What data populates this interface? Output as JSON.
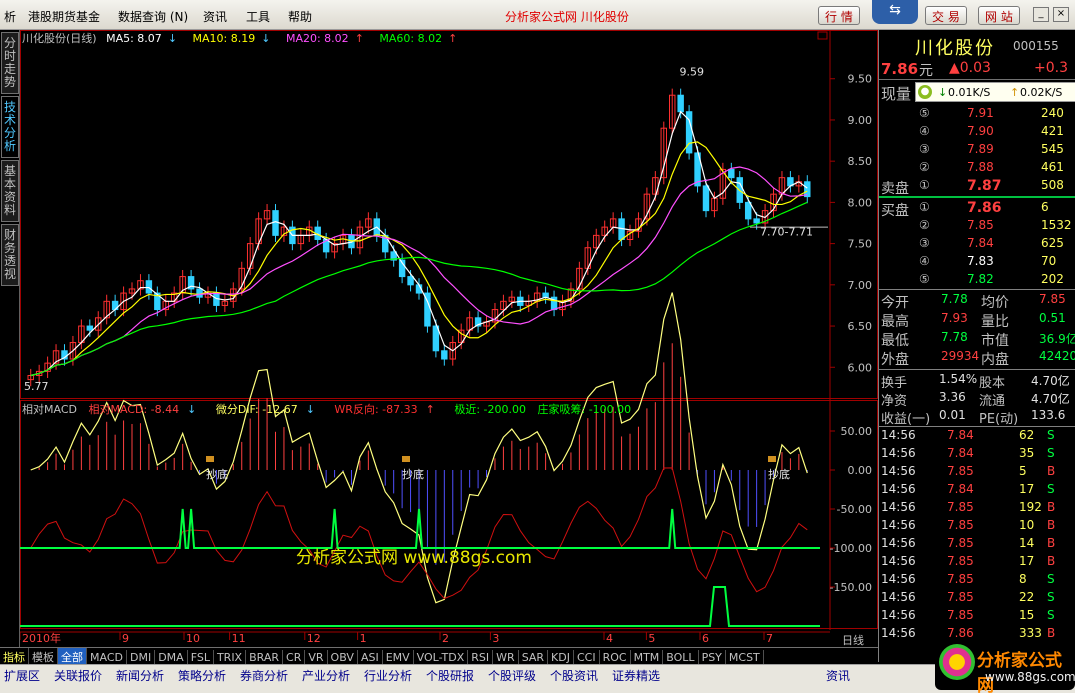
{
  "menu": {
    "items": [
      "析",
      "港股期货基金",
      "数据查询 (N)",
      "资讯",
      "工具",
      "帮助"
    ],
    "title": "分析家公式网  川化股份",
    "btn_hq": "行 情",
    "btn_jy": "交 易",
    "btn_wz": "网 站",
    "btn_zx": "资讯"
  },
  "side_tabs": [
    "分时走势",
    "技术分析",
    "基本资料",
    "财务透视"
  ],
  "main_header": {
    "stock": "川化股份(日线)",
    "ma5": "MA5: 8.07",
    "ma10": "MA10: 8.19",
    "ma20": "MA20: 8.02",
    "ma60": "MA60: 8.02",
    "arrows": [
      "↓",
      "↓",
      "↑",
      "↑"
    ],
    "colors": {
      "ma5": "#ffffff",
      "ma10": "#ffff00",
      "ma20": "#ff50ff",
      "ma60": "#00ff00"
    }
  },
  "indicator_header": {
    "name": "相对MACD",
    "macd": "相对MACD: -8.44",
    "dif": "微分DIF: -12.67",
    "wr": "WR反向: -87.33",
    "ext": "极近: -200.00",
    "zj": "庄家吸筹: -100.00"
  },
  "chart_data": {
    "type": "candlestick",
    "price_axis": {
      "ticks": [
        "9.50",
        "9.00",
        "8.50",
        "8.00",
        "7.50",
        "7.00",
        "6.50",
        "6.00"
      ],
      "values": [
        9.5,
        9.0,
        8.5,
        8.0,
        7.5,
        7.0,
        6.5,
        6.0
      ],
      "ylim": [
        5.7,
        9.8
      ]
    },
    "indicator_axis": {
      "ticks": [
        "50.00",
        "0.00",
        "-50.00",
        "-100.00",
        "-150.00"
      ],
      "values": [
        50,
        0,
        -50,
        -100,
        -150
      ]
    },
    "x_labels": [
      "2010年",
      "9",
      "10",
      "11",
      "12",
      "1",
      "2",
      "3",
      "4",
      "5",
      "6",
      "7"
    ],
    "x_positions": [
      0,
      0.125,
      0.205,
      0.262,
      0.356,
      0.422,
      0.525,
      0.588,
      0.73,
      0.783,
      0.85,
      0.93
    ],
    "annotations": {
      "high": "9.59",
      "low": "5.77",
      "range": "7.70-7.71",
      "bottom_labels": [
        "抄底",
        "抄底",
        "抄底"
      ]
    },
    "closes": [
      5.9,
      5.95,
      6.05,
      6.2,
      6.1,
      6.3,
      6.5,
      6.45,
      6.6,
      6.8,
      6.7,
      6.9,
      6.95,
      7.05,
      6.9,
      6.7,
      6.8,
      6.9,
      7.1,
      6.95,
      6.85,
      6.9,
      6.75,
      6.8,
      6.95,
      7.2,
      7.5,
      7.8,
      7.9,
      7.6,
      7.7,
      7.5,
      7.6,
      7.7,
      7.55,
      7.4,
      7.5,
      7.6,
      7.45,
      7.7,
      7.8,
      7.6,
      7.4,
      7.3,
      7.1,
      7.0,
      6.9,
      6.5,
      6.2,
      6.1,
      6.3,
      6.45,
      6.6,
      6.5,
      6.55,
      6.7,
      6.8,
      6.85,
      6.75,
      6.8,
      6.9,
      6.85,
      6.7,
      6.8,
      6.95,
      7.2,
      7.45,
      7.6,
      7.7,
      7.8,
      7.55,
      7.65,
      7.8,
      8.1,
      8.3,
      8.9,
      9.3,
      9.1,
      8.6,
      8.2,
      7.9,
      8.05,
      8.4,
      8.3,
      8.0,
      7.8,
      7.75,
      7.9,
      8.1,
      8.3,
      8.2,
      8.25,
      8.07
    ]
  },
  "quote": {
    "name": "川化股份",
    "code": "000155",
    "price": "7.86",
    "unit": "元",
    "chg": "▲0.03",
    "chg2": "+0.3",
    "xianliang": "现量",
    "vol_dn": "0.01K/S",
    "vol_up": "0.02K/S",
    "asks": [
      [
        "⑤",
        "7.91",
        "240"
      ],
      [
        "④",
        "7.90",
        "421"
      ],
      [
        "③",
        "7.89",
        "545"
      ],
      [
        "②",
        "7.88",
        "461"
      ],
      [
        "①",
        "7.87",
        "508"
      ]
    ],
    "bids": [
      [
        "①",
        "7.86",
        "6"
      ],
      [
        "②",
        "7.85",
        "1532"
      ],
      [
        "③",
        "7.84",
        "625"
      ],
      [
        "④",
        "7.83",
        "70"
      ],
      [
        "⑤",
        "7.82",
        "202"
      ]
    ],
    "sell_label": "卖盘",
    "buy_label": "买盘",
    "stats": [
      [
        "今开",
        "7.78",
        "均价",
        "7.85"
      ],
      [
        "最高",
        "7.93",
        "量比",
        "0.51"
      ],
      [
        "最低",
        "7.78",
        "市值",
        "36.9亿"
      ],
      [
        "外盘",
        "29934",
        "内盘",
        "42420"
      ]
    ],
    "stats2": [
      [
        "换手",
        "1.54%",
        "股本",
        "4.70亿"
      ],
      [
        "净资",
        "3.36",
        "流通",
        "4.70亿"
      ],
      [
        "收益(一)",
        "0.01",
        "PE(动)",
        "133.6"
      ]
    ],
    "ticks": [
      [
        "14:56",
        "7.84",
        "62",
        "S"
      ],
      [
        "14:56",
        "7.84",
        "35",
        "S"
      ],
      [
        "14:56",
        "7.85",
        "5",
        "B"
      ],
      [
        "14:56",
        "7.84",
        "17",
        "S"
      ],
      [
        "14:56",
        "7.85",
        "192",
        "B"
      ],
      [
        "14:56",
        "7.85",
        "10",
        "B"
      ],
      [
        "14:56",
        "7.85",
        "14",
        "B"
      ],
      [
        "14:56",
        "7.85",
        "17",
        "B"
      ],
      [
        "14:56",
        "7.85",
        "8",
        "S"
      ],
      [
        "14:56",
        "7.85",
        "22",
        "S"
      ],
      [
        "14:56",
        "7.85",
        "15",
        "S"
      ],
      [
        "14:56",
        "7.86",
        "333",
        "B"
      ]
    ]
  },
  "indicator_tabs": [
    "指标",
    "模板",
    "全部",
    "MACD",
    "DMI",
    "DMA",
    "FSL",
    "TRIX",
    "BRAR",
    "CR",
    "VR",
    "OBV",
    "ASI",
    "EMV",
    "VOL-TDX",
    "RSI",
    "WR",
    "SAR",
    "KDJ",
    "CCI",
    "ROC",
    "MTM",
    "BOLL",
    "PSY",
    "MCST"
  ],
  "period_label": "日线",
  "bottom_nav": [
    "扩展区",
    "关联报价",
    "新闻分析",
    "策略分析",
    "券商分析",
    "产业分析",
    "行业分析",
    "个股研报",
    "个股评级",
    "个股资讯",
    "证券精选"
  ],
  "watermark": "分析家公式网 www.88gs.com",
  "brand": {
    "name": "分析家公式网",
    "url": "www.88gs.com"
  }
}
